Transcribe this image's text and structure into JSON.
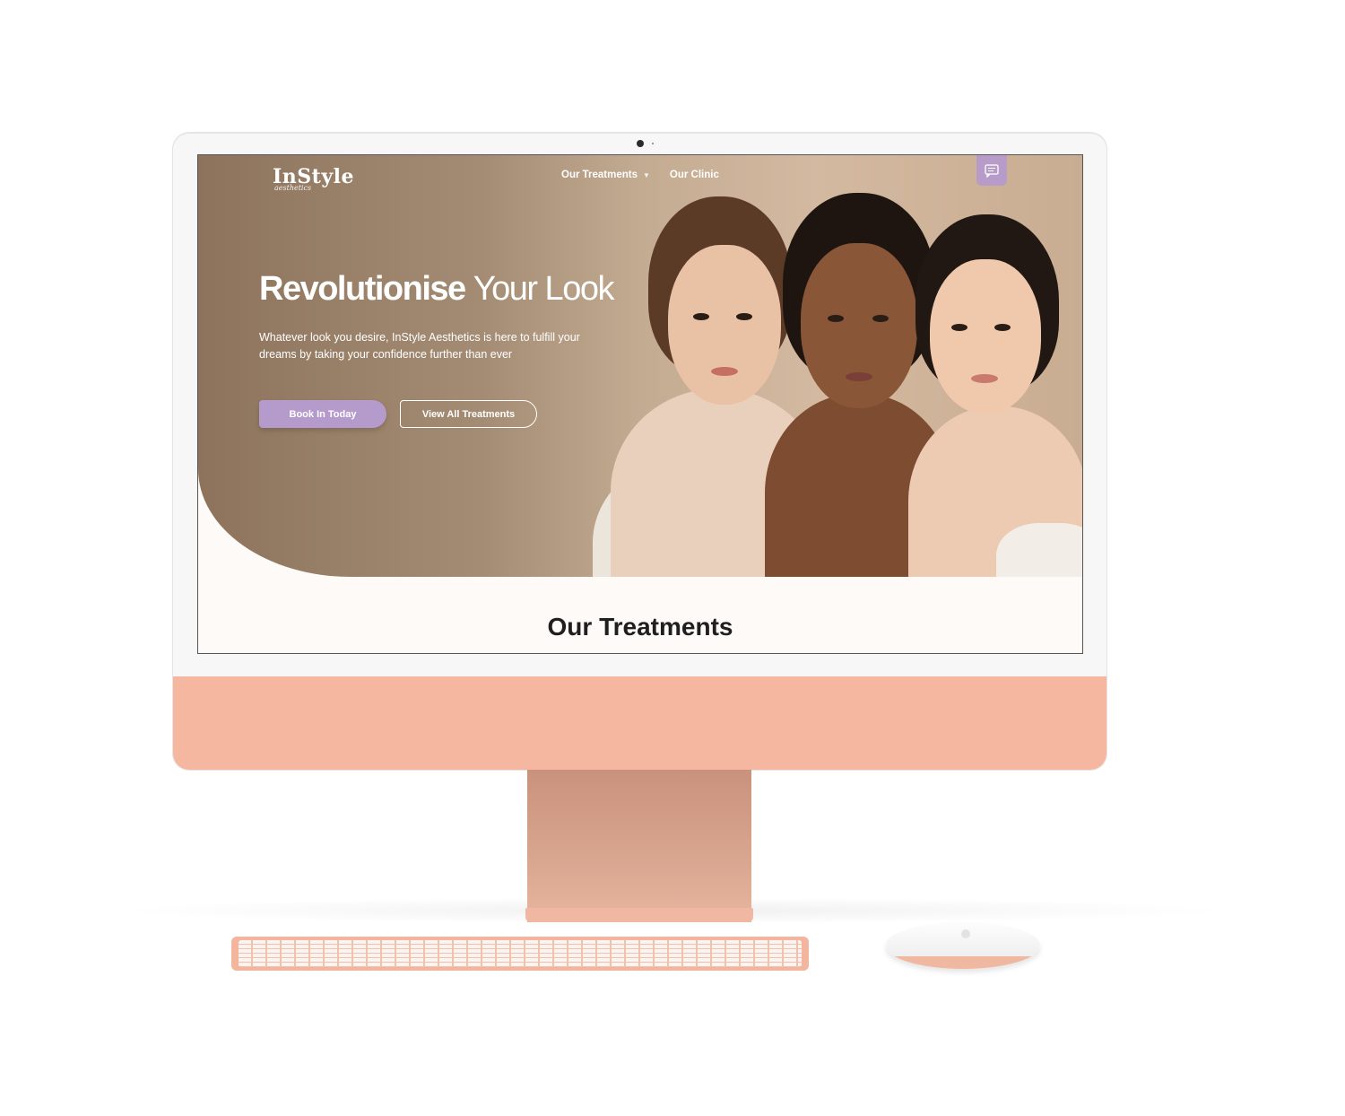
{
  "site": {
    "logo_text": "InStyle",
    "logo_subtext": "aesthetics"
  },
  "nav": {
    "items": [
      {
        "label": "Our Treatments",
        "has_dropdown": true
      },
      {
        "label": "Our Clinic",
        "has_dropdown": false
      }
    ],
    "dropdown_icon": "chevron-down-icon",
    "chat_icon": "chat-icon"
  },
  "hero": {
    "headline_bold": "Revolutionise",
    "headline_light": "Your Look",
    "subtext": "Whatever look you desire, InStyle Aesthetics is here to fulfill your dreams by taking your confidence further than ever",
    "primary_button": "Book In Today",
    "secondary_button": "View All Treatments"
  },
  "sections": {
    "treatments_title": "Our Treatments"
  },
  "colors": {
    "accent": "#b59bcb",
    "hero_dark": "#8d735b",
    "hero_light": "#d3b9a0",
    "device": "#f6b7a0",
    "page_bg": "#fdfaf8"
  }
}
